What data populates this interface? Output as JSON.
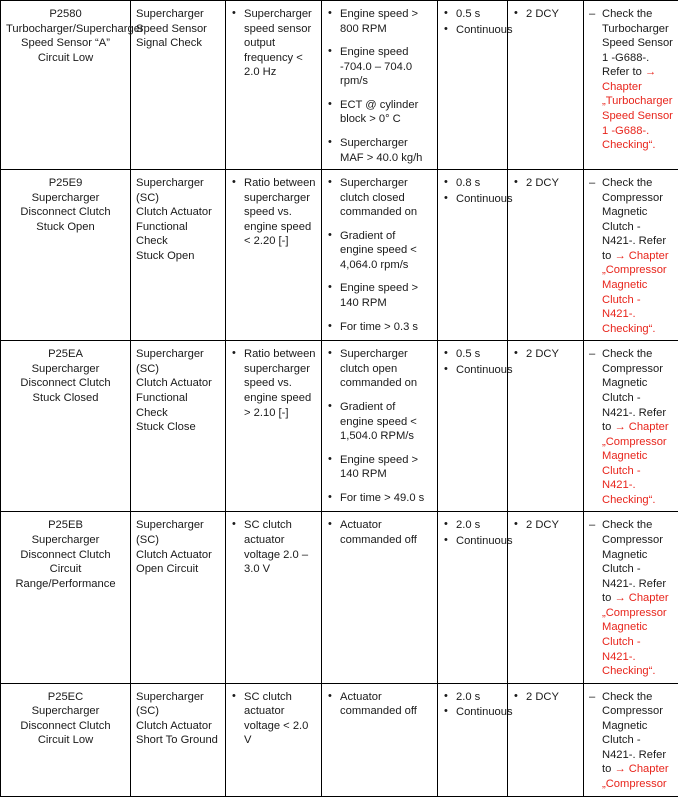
{
  "table": {
    "columns": [
      "dtc-code",
      "check-performed",
      "fault-criteria",
      "enable-conditions",
      "monitoring-time",
      "drive-cycles",
      "corrective-action"
    ],
    "rows": [
      {
        "code": "P2580",
        "code_desc": "Turbocharger/Supercharger Speed Sensor “A” Circuit Low",
        "check": [
          "Supercharger",
          "Speed Sensor",
          "Signal Check"
        ],
        "fault": [
          "Supercharger speed sensor output frequency < 2.0 Hz"
        ],
        "enable": [
          "Engine speed > 800 RPM",
          "Engine speed -704.0 – 704.0 rpm/s",
          "ECT @ cylinder block > 0° C",
          "Supercharger MAF > 40.0 kg/h"
        ],
        "time": [
          "0.5 s",
          "Continuous"
        ],
        "cycles": [
          "2 DCY"
        ],
        "action": {
          "lead": "Check the Turbocharger Speed Sensor 1 -G688-. Refer to",
          "arrow": "→",
          "ref": " Chapter „Turbocharger Speed Sensor 1 -G688-. Checking“."
        }
      },
      {
        "code": "P25E9",
        "code_desc": "Supercharger Disconnect Clutch Stuck Open",
        "check": [
          "Supercharger (SC)",
          "Clutch Actuator",
          "Functional Check",
          "Stuck Open"
        ],
        "fault": [
          "Ratio between supercharger speed vs. engine speed < 2.20 [-]"
        ],
        "enable": [
          "Supercharger clutch closed commanded on",
          "Gradient of engine speed < 4,064.0 rpm/s",
          "Engine speed > 140 RPM",
          "For time > 0.3 s"
        ],
        "time": [
          "0.8 s",
          "Continuous"
        ],
        "cycles": [
          "2 DCY"
        ],
        "action": {
          "lead": "Check the Compressor Magnetic Clutch -N421-. Refer to",
          "arrow": "→",
          "ref": " Chapter „Compressor Magnetic Clutch -N421-. Checking“."
        }
      },
      {
        "code": "P25EA",
        "code_desc": "Supercharger Disconnect Clutch Stuck Closed",
        "check": [
          "Supercharger (SC)",
          "Clutch Actuator",
          "Functional Check",
          "Stuck Close"
        ],
        "fault": [
          "Ratio between supercharger speed vs. engine speed > 2.10 [-]"
        ],
        "enable": [
          "Supercharger clutch open commanded on",
          "Gradient of engine speed < 1,504.0 RPM/s",
          "Engine speed > 140 RPM",
          "For time > 49.0 s"
        ],
        "time": [
          "0.5 s",
          "Continuous"
        ],
        "cycles": [
          "2 DCY"
        ],
        "action": {
          "lead": "Check the Compressor Magnetic Clutch -N421-. Refer to",
          "arrow": "→",
          "ref": " Chapter „Compressor Magnetic Clutch -N421-. Checking“."
        }
      },
      {
        "code": "P25EB",
        "code_desc": "Supercharger Disconnect Clutch Circuit Range/Performance",
        "check": [
          "Supercharger (SC)",
          "Clutch Actuator",
          "Open Circuit"
        ],
        "fault": [
          "SC clutch actuator voltage 2.0 – 3.0 V"
        ],
        "enable": [
          "Actuator commanded off"
        ],
        "time": [
          "2.0 s",
          "Continuous"
        ],
        "cycles": [
          "2 DCY"
        ],
        "action": {
          "lead": "Check the Compressor Magnetic Clutch -N421-. Refer to",
          "arrow": "→",
          "ref": " Chapter „Compressor Magnetic Clutch -N421-. Checking“."
        }
      },
      {
        "code": "P25EC",
        "code_desc": "Supercharger Disconnect Clutch Circuit Low",
        "check": [
          "Supercharger (SC)",
          "Clutch Actuator",
          "Short To Ground"
        ],
        "fault": [
          "SC clutch actuator voltage < 2.0 V"
        ],
        "enable": [
          "Actuator commanded off"
        ],
        "time": [
          "2.0 s",
          "Continuous"
        ],
        "cycles": [
          "2 DCY"
        ],
        "action": {
          "lead": "Check the Compressor Magnetic Clutch -N421-. Refer to",
          "arrow": "→",
          "ref": " Chapter „Compressor"
        }
      }
    ]
  },
  "colors": {
    "reference_red": "#e8251c",
    "text": "#1a1a1a",
    "border": "#000000"
  }
}
